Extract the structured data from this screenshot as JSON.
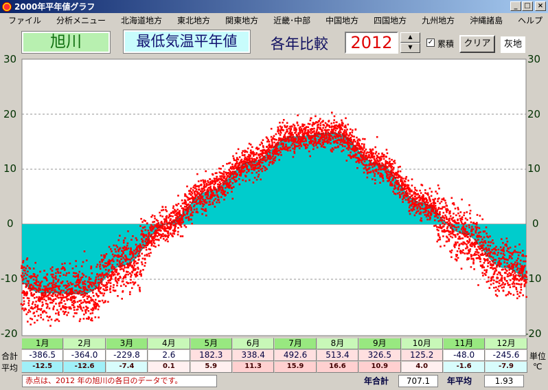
{
  "window": {
    "title": "2000年平年値グラフ",
    "minimize": "_",
    "maximize": "□",
    "close": "×"
  },
  "menu": [
    "ファイル",
    "分析メニュー",
    "北海道地方",
    "東北地方",
    "関東地方",
    "近畿･中部",
    "中国地方",
    "四国地方",
    "九州地方",
    "沖縄諸島",
    "ヘルプ"
  ],
  "toolbar": {
    "station": "旭川",
    "measure": "最低気温平年値",
    "compare_label": "各年比較",
    "year": "2012",
    "spin_up": "▲",
    "spin_down": "▼",
    "cumulative_checked": "✓",
    "cumulative_label": "累積",
    "clear_label": "クリア",
    "gray_label": "灰地"
  },
  "colors": {
    "normal_fill": "#00cccc",
    "normal_fill_neg": "#00b0b0",
    "daily_points": "#ff0000",
    "normal_line": "#404040"
  },
  "chart_data": {
    "type": "area",
    "ylim": [
      -20,
      30
    ],
    "y_ticks": [
      "30",
      "20",
      "10",
      "0",
      "-10",
      "-20"
    ],
    "x": [
      "1月",
      "2月",
      "3月",
      "4月",
      "5月",
      "6月",
      "7月",
      "8月",
      "9月",
      "10月",
      "11月",
      "12月"
    ],
    "series": [
      {
        "values": [
          -12.5,
          -12.6,
          -7.4,
          0.1,
          5.9,
          11.3,
          15.9,
          16.6,
          10.9,
          4.0,
          -1.6,
          -7.9
        ]
      }
    ]
  },
  "table": {
    "total_label": "合計",
    "avg_label": "平均",
    "unit_label": "単位",
    "unit_value": "℃",
    "months": [
      "1月",
      "2月",
      "3月",
      "4月",
      "5月",
      "6月",
      "7月",
      "8月",
      "9月",
      "10月",
      "11月",
      "12月"
    ],
    "totals": [
      "-386.5",
      "-364.0",
      "-229.8",
      "2.6",
      "182.3",
      "338.4",
      "492.6",
      "513.4",
      "326.5",
      "125.2",
      "-48.0",
      "-245.6"
    ],
    "averages": [
      "-12.5",
      "-12.6",
      "-7.4",
      "0.1",
      "5.9",
      "11.3",
      "15.9",
      "16.6",
      "10.9",
      "4.0",
      "-1.6",
      "-7.9"
    ]
  },
  "footer": {
    "note": "赤点は、2012 年の旭川の各日のデータです。",
    "year_total_label": "年合計",
    "year_total": "707.1",
    "year_avg_label": "年平均",
    "year_avg": "1.93"
  }
}
